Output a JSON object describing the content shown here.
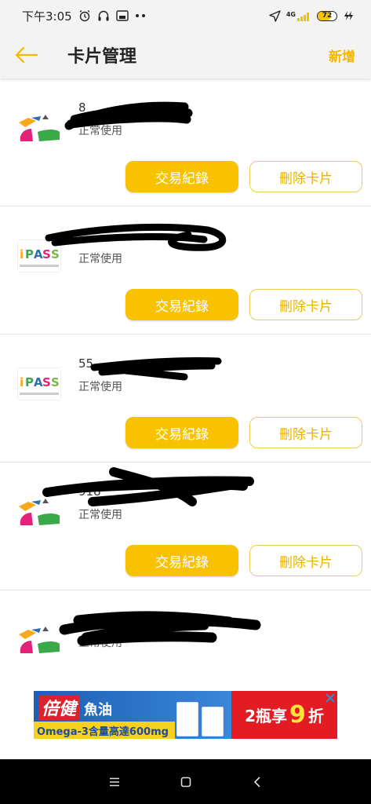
{
  "status_bar": {
    "time": "下午3:05",
    "network": "4G",
    "battery": "72"
  },
  "header": {
    "title": "卡片管理",
    "add_label": "新增"
  },
  "cards": [
    {
      "number": "8",
      "status": "正常使用",
      "logo": "easycard-logo",
      "records_label": "交易紀錄",
      "delete_label": "刪除卡片"
    },
    {
      "number": "",
      "status": "正常使用",
      "logo": "ipass-logo",
      "records_label": "交易紀錄",
      "delete_label": "刪除卡片"
    },
    {
      "number": "55",
      "status": "正常使用",
      "logo": "ipass-logo",
      "records_label": "交易紀錄",
      "delete_label": "刪除卡片"
    },
    {
      "number": "918",
      "status": "正常使用",
      "logo": "easycard-logo",
      "records_label": "交易紀錄",
      "delete_label": "刪除卡片"
    },
    {
      "number": "",
      "status": "正常使用",
      "logo": "easycard-logo"
    }
  ],
  "ad": {
    "brand": "倍健",
    "product": "魚油",
    "desc": "Omega-3含量高達600mg",
    "promo_prefix": "2瓶享",
    "promo_number": "9",
    "promo_suffix": "折"
  },
  "colors": {
    "accent": "#f9c200",
    "accent_text": "#f5b800",
    "delete_border": "#f0cc55",
    "ad_blue": "#1d5fb5",
    "ad_red": "#e31b23"
  }
}
